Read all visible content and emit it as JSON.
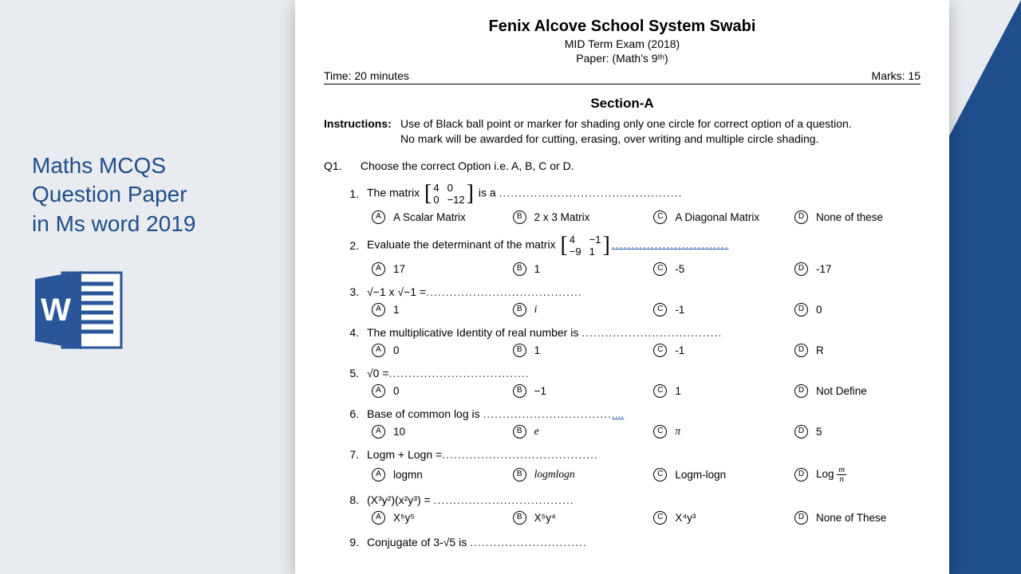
{
  "left": {
    "line1": "Maths MCQS",
    "line2": "Question Paper",
    "line3": "in Ms word 2019"
  },
  "header": {
    "school": "Fenix Alcove School System Swabi",
    "mid": "MID Term Exam (2018)",
    "paper": "Paper: (Math's 9ᵗʰ)",
    "time": "Time: 20 minutes",
    "marks": "Marks: 15"
  },
  "section": "Section-A",
  "instr_label": "Instructions:",
  "instr_l1": "Use of Black ball point or marker for shading only one circle for correct option of a question.",
  "instr_l2": "No mark will be awarded for cutting, erasing, over writing and multiple circle shading.",
  "q1": {
    "label": "Q1.",
    "text": "Choose the correct Option i.e. A, B, C or D."
  },
  "questions": [
    {
      "n": "1.",
      "stem_pre": "The matrix ",
      "matrix": [
        "4",
        "0",
        "0",
        "−12"
      ],
      "stem_post": " is a ",
      "opts": {
        "A": "A Scalar Matrix",
        "B": "2 x 3 Matrix",
        "C": "A Diagonal Matrix",
        "D": "None of these"
      }
    },
    {
      "n": "2.",
      "stem_pre": "Evaluate the determinant of the matrix  ",
      "matrix": [
        "4",
        "−1",
        "−9",
        "1"
      ],
      "stem_post": "",
      "opts": {
        "A": "17",
        "B": "1",
        "C": "-5",
        "D": "-17"
      }
    },
    {
      "n": "3.",
      "stem_html": "√−1 x √−1 =",
      "opts": {
        "A": "1",
        "B": "i",
        "C": "-1",
        "D": "0"
      }
    },
    {
      "n": "4.",
      "stem_html": "The multiplicative Identity of real number is ",
      "opts": {
        "A": "0",
        "B": "1",
        "C": "-1",
        "D": "R"
      }
    },
    {
      "n": "5.",
      "stem_html": "√0 =",
      "opts": {
        "A": "0",
        "B": "−1",
        "C": "1",
        "D": "Not Define"
      }
    },
    {
      "n": "6.",
      "stem_html": "Base of common log is ",
      "opts": {
        "A": "10",
        "B": "e",
        "C": "π",
        "D": "5"
      }
    },
    {
      "n": "7.",
      "stem_html": "Logm + Logn =",
      "opts": {
        "A": "logmn",
        "B": "logmlogn",
        "C": "Logm-logn",
        "D": "Log m/n"
      }
    },
    {
      "n": "8.",
      "stem_html": "(X³y²)(x²y³) = ",
      "opts": {
        "A": "X⁵y⁵",
        "B": "X⁵y⁴",
        "C": "X⁴y³",
        "D": "None of These"
      }
    },
    {
      "n": "9.",
      "stem_html": "Conjugate of 3-√5 is ",
      "opts": {
        "A": "",
        "B": "",
        "C": "",
        "D": ""
      }
    }
  ]
}
